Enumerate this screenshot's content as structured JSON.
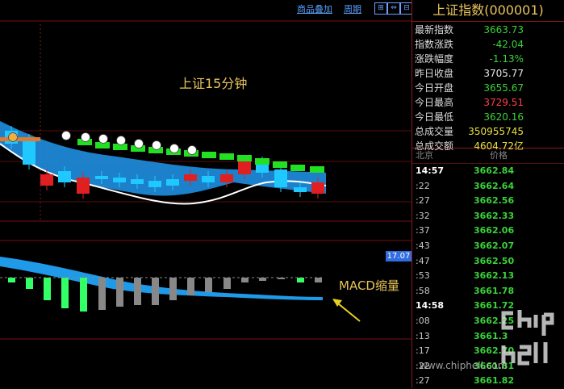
{
  "toolbar": {
    "overlay_label": "商品叠加",
    "period_label": "周期"
  },
  "annotations": {
    "chart_title": "上证15分钟",
    "macd_note": "MACD缩量",
    "macd_value": "17.07"
  },
  "panel": {
    "title": "上证指数(000001)",
    "stats": [
      {
        "label": "最新指数",
        "value": "3663.73",
        "color": "#3ad33a"
      },
      {
        "label": "指数涨跌",
        "value": "-42.04",
        "color": "#3ad33a"
      },
      {
        "label": "涨跌幅度",
        "value": "-1.13%",
        "color": "#3ad33a"
      },
      {
        "label": "昨日收盘",
        "value": "3705.77",
        "color": "#e8e8e8"
      },
      {
        "label": "今日开盘",
        "value": "3655.67",
        "color": "#3ad33a"
      },
      {
        "label": "今日最高",
        "value": "3729.51",
        "color": "#ff4040"
      },
      {
        "label": "今日最低",
        "value": "3620.16",
        "color": "#3ad33a"
      },
      {
        "label": "总成交量",
        "value": "350955745",
        "color": "#e8e040"
      },
      {
        "label": "总成交额",
        "value": "4604.72亿",
        "color": "#e8e040"
      }
    ],
    "tick_header": {
      "location": "北京",
      "price_label": "价格"
    },
    "ticks": [
      {
        "time": "14:57",
        "price": "3662.84",
        "major": true
      },
      {
        "time": ":22",
        "price": "3662.64",
        "major": false
      },
      {
        "time": ":27",
        "price": "3662.56",
        "major": false
      },
      {
        "time": ":32",
        "price": "3662.33",
        "major": false
      },
      {
        "time": ":37",
        "price": "3662.06",
        "major": false
      },
      {
        "time": ":43",
        "price": "3662.07",
        "major": false
      },
      {
        "time": ":47",
        "price": "3662.50",
        "major": false
      },
      {
        "time": ":53",
        "price": "3662.13",
        "major": false
      },
      {
        "time": ":58",
        "price": "3661.78",
        "major": false
      },
      {
        "time": "14:58",
        "price": "3661.72",
        "major": true
      },
      {
        "time": ":08",
        "price": "3662.25",
        "major": false
      },
      {
        "time": ":13",
        "price": "3661.3",
        "major": false
      },
      {
        "time": ":17",
        "price": "3662.70",
        "major": false
      },
      {
        "time": ":22",
        "price": "3661.81",
        "major": false
      },
      {
        "time": ":27",
        "price": "3661.82",
        "major": false
      }
    ]
  },
  "watermark": {
    "site": "www.chiphell.com",
    "logo_text": "chip hell"
  },
  "colors": {
    "up": "#e02020",
    "down": "#1fc8ff",
    "macd_pos": "#888888",
    "macd_neg": "#33ff66",
    "grid": "#7a1010"
  }
}
